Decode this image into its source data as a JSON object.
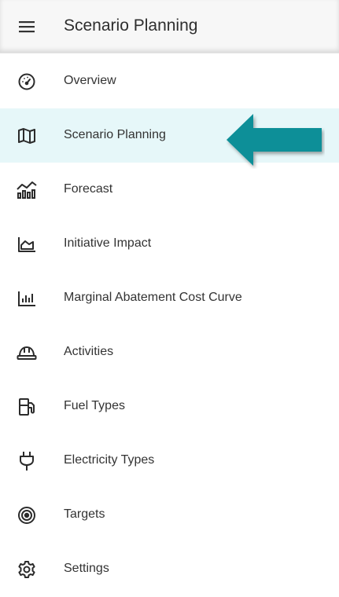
{
  "header": {
    "title": "Scenario Planning",
    "menu_icon": "hamburger-menu-icon"
  },
  "nav": {
    "active_index": 1,
    "items": [
      {
        "label": "Overview",
        "icon": "dashboard-gauge-icon"
      },
      {
        "label": "Scenario Planning",
        "icon": "map-icon"
      },
      {
        "label": "Forecast",
        "icon": "forecast-chart-icon"
      },
      {
        "label": "Initiative Impact",
        "icon": "area-chart-icon"
      },
      {
        "label": "Marginal Abatement Cost Curve",
        "icon": "bar-chart-icon"
      },
      {
        "label": "Activities",
        "icon": "hard-hat-icon"
      },
      {
        "label": "Fuel Types",
        "icon": "fuel-pump-icon"
      },
      {
        "label": "Electricity Types",
        "icon": "power-plug-icon"
      },
      {
        "label": "Targets",
        "icon": "target-icon"
      },
      {
        "label": "Settings",
        "icon": "gear-icon"
      }
    ]
  },
  "colors": {
    "active_background": "#e6f7f9",
    "arrow": "#0e8f98",
    "icon": "#2b2b2b"
  }
}
